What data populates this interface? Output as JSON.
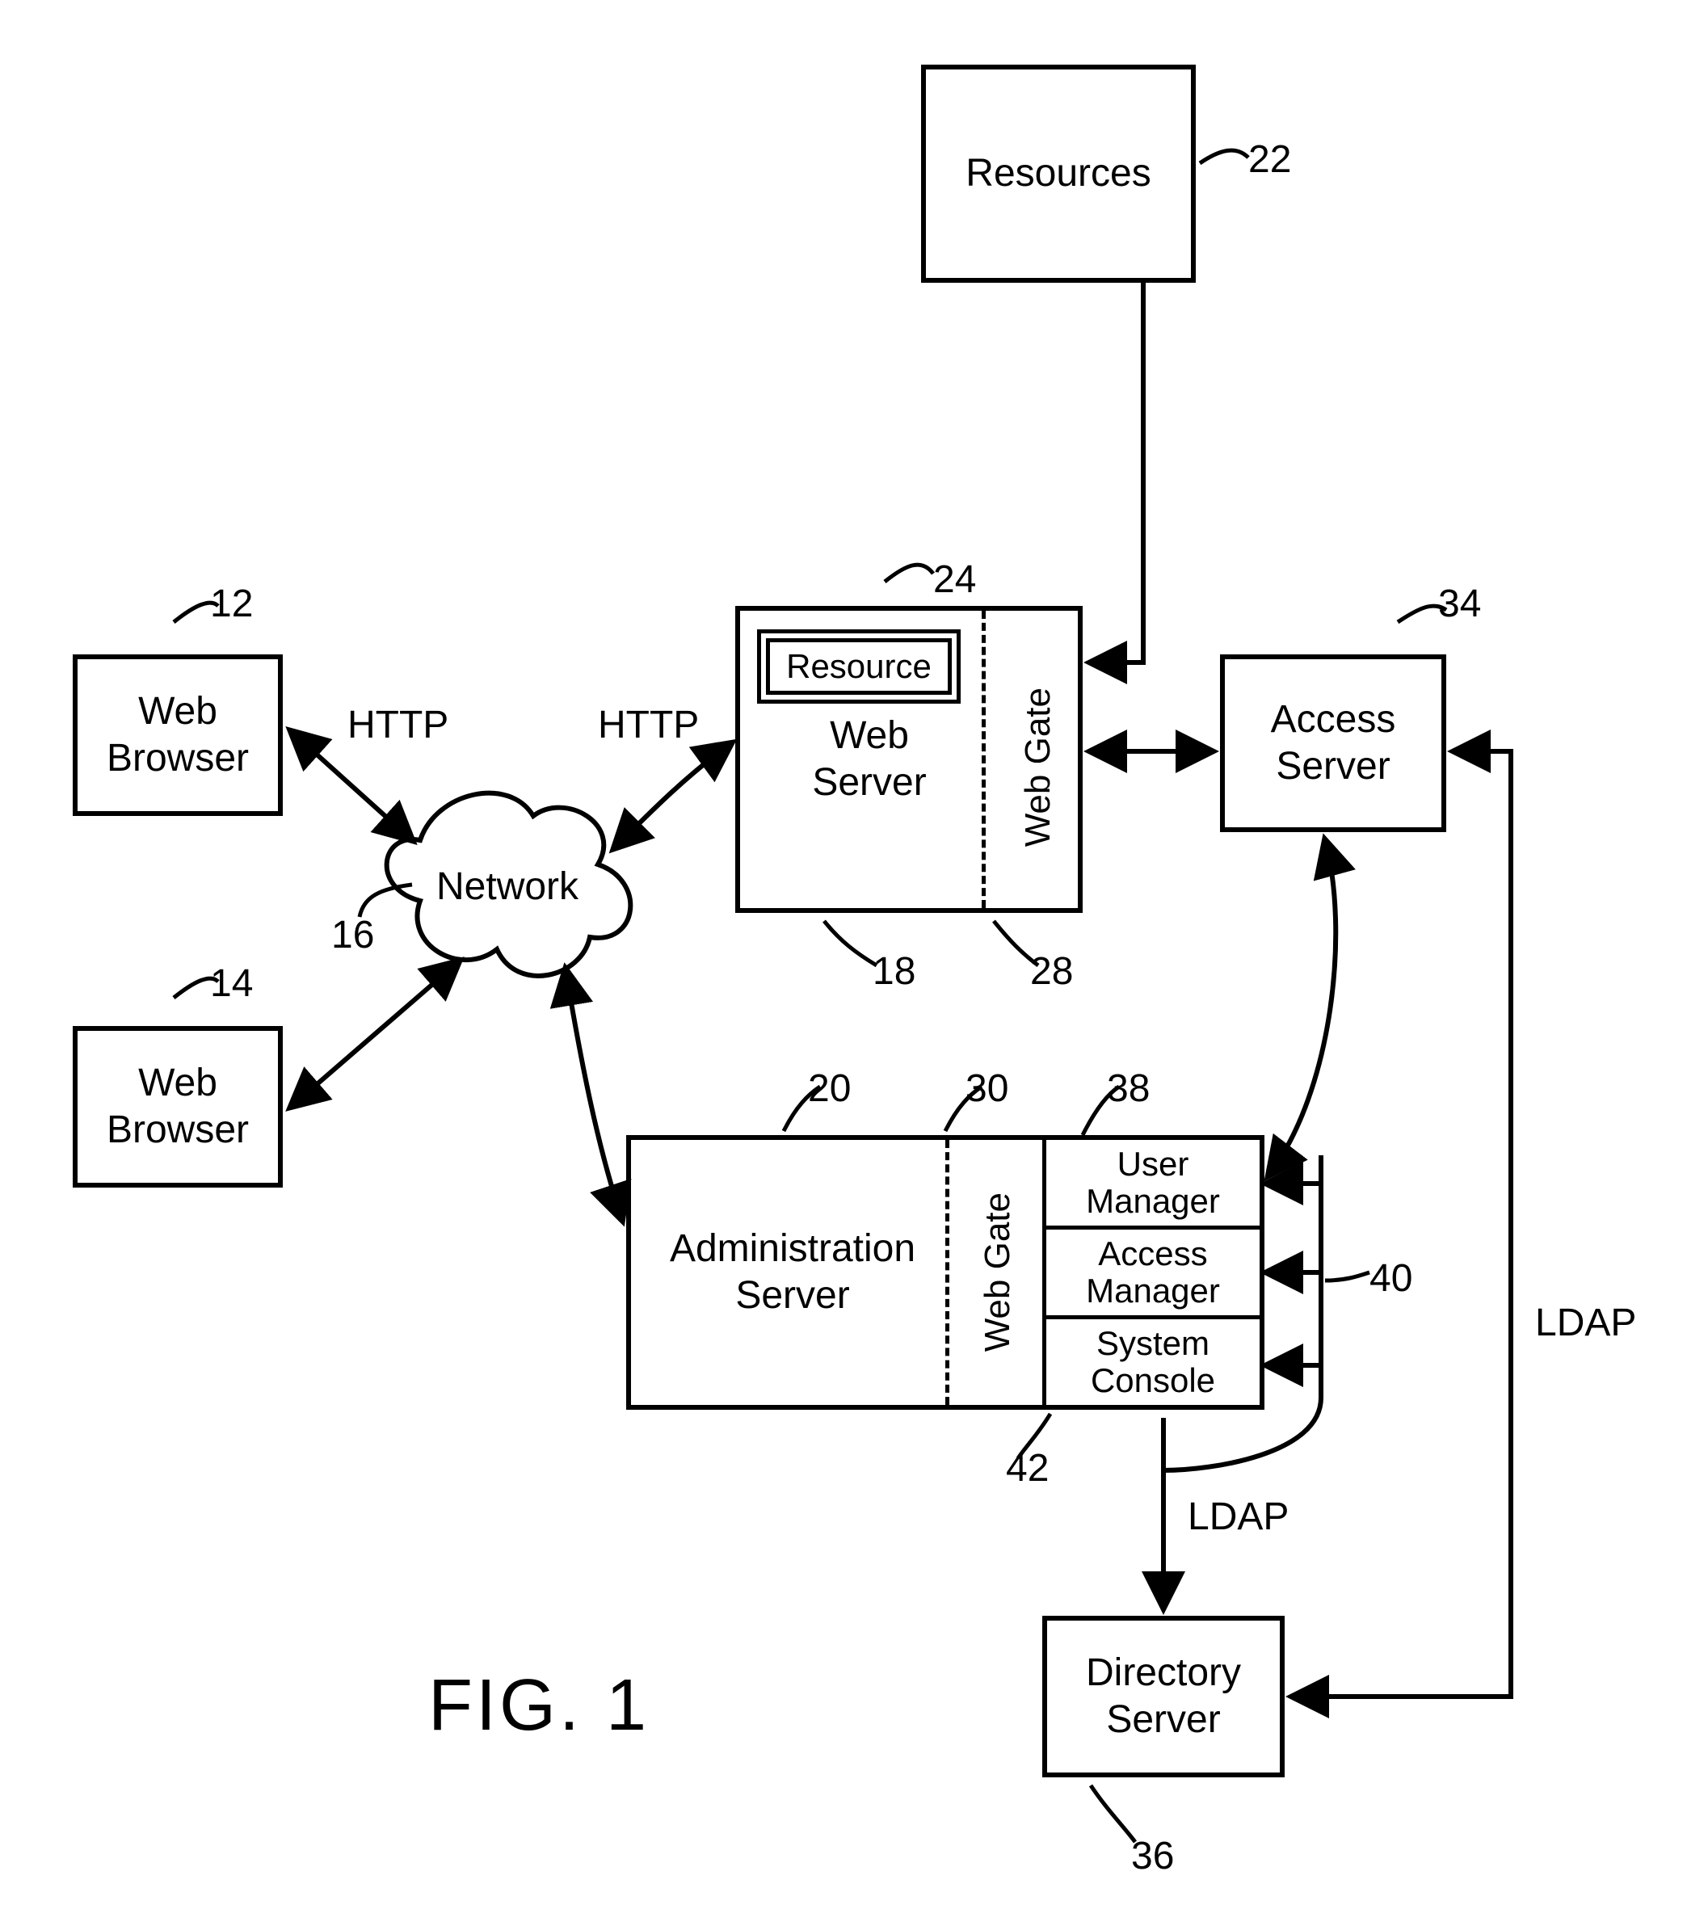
{
  "nodes": {
    "resources": {
      "label": "Resources",
      "ref": "22"
    },
    "web_browser_1": {
      "label": "Web\nBrowser",
      "ref": "12"
    },
    "web_browser_2": {
      "label": "Web\nBrowser",
      "ref": "14"
    },
    "network": {
      "label": "Network",
      "ref": "16"
    },
    "web_server": {
      "label": "Web\nServer",
      "ref": "18"
    },
    "web_server_resource": {
      "label": "Resource",
      "ref": "24"
    },
    "web_server_gate": {
      "label": "Web Gate",
      "ref": "28"
    },
    "access_server": {
      "label": "Access\nServer",
      "ref": "34"
    },
    "admin_server": {
      "label": "Administration\nServer",
      "ref": "20"
    },
    "admin_gate": {
      "label": "Web Gate",
      "ref": "30"
    },
    "user_manager": {
      "label": "User\nManager",
      "ref": "38"
    },
    "access_manager": {
      "label": "Access\nManager",
      "ref": "40"
    },
    "system_console": {
      "label": "System\nConsole",
      "ref": "42"
    },
    "directory_server": {
      "label": "Directory\nServer",
      "ref": "36"
    }
  },
  "edges": {
    "http1": "HTTP",
    "http2": "HTTP",
    "ldap1": "LDAP",
    "ldap2": "LDAP"
  },
  "figure": "FIG. 1"
}
